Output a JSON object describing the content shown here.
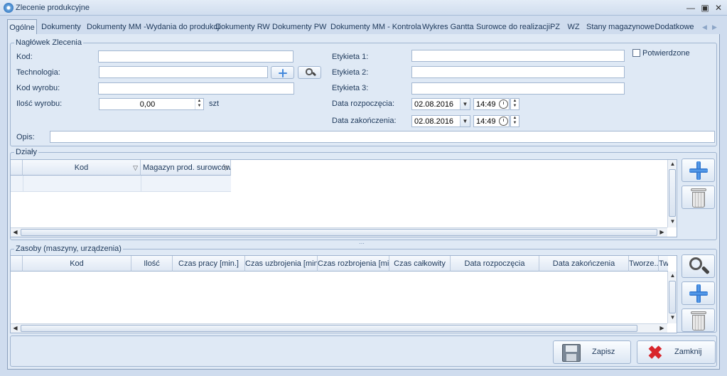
{
  "window": {
    "title": "Zlecenie produkcyjne",
    "icon": "app-icon",
    "buttons": [
      "minimize",
      "maximize",
      "close"
    ]
  },
  "tabs": [
    {
      "label": "Ogólne",
      "active": true
    },
    {
      "label": "Dokumenty"
    },
    {
      "label": "Dokumenty MM -Wydania do produkcji"
    },
    {
      "label": "Dokumenty RW"
    },
    {
      "label": "Dokumenty PW"
    },
    {
      "label": "Dokumenty MM - Kontrola"
    },
    {
      "label": "Wykres Gantta"
    },
    {
      "label": "Surowce do realizacji"
    },
    {
      "label": "PZ"
    },
    {
      "label": "WZ"
    },
    {
      "label": "Stany magazynowe"
    },
    {
      "label": "Dodatkowe"
    }
  ],
  "header": {
    "group_label": "Nagłówek Zlecenia",
    "kod_label": "Kod:",
    "kod_value": "",
    "technologia_label": "Technologia:",
    "technologia_value": "",
    "kod_wyrobu_label": "Kod wyrobu:",
    "kod_wyrobu_value": "",
    "ilosc_label": "Ilość wyrobu:",
    "ilosc_value": "0,00",
    "ilosc_unit": "szt",
    "etykieta1_label": "Etykieta 1:",
    "etykieta1_value": "",
    "etykieta2_label": "Etykieta 2:",
    "etykieta2_value": "",
    "etykieta3_label": "Etykieta 3:",
    "etykieta3_value": "",
    "data_rozp_label": "Data rozpoczęcia:",
    "data_rozp_date": "02.08.2016",
    "data_rozp_time": "14:49",
    "data_zak_label": "Data zakończenia:",
    "data_zak_date": "02.08.2016",
    "data_zak_time": "14:49",
    "potwierdzone_label": "Potwierdzone",
    "potwierdzone_checked": false,
    "opis_label": "Opis:",
    "opis_value": ""
  },
  "dzialy": {
    "group_label": "Działy",
    "columns": [
      "Kod",
      "Magazyn prod. surowców"
    ]
  },
  "zasoby": {
    "group_label": "Zasoby (maszyny, urządzenia)",
    "columns": [
      "Kod",
      "Ilość",
      "Czas pracy [min.]",
      "Czas uzbrojenia  [min.]",
      "Czas rozbrojenia  [mi...",
      "Czas całkowity",
      "Data rozpoczęcia",
      "Data zakończenia",
      "Tworze...",
      "Tw"
    ]
  },
  "footer": {
    "save_label": "Zapisz",
    "close_label": "Zamknij"
  }
}
